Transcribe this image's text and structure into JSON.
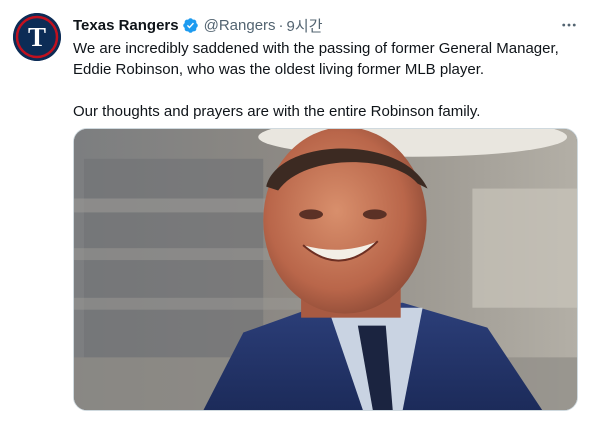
{
  "tweet": {
    "author_name": "Texas Rangers",
    "handle": "@Rangers",
    "separator": "·",
    "time": "9시간",
    "text_paragraph_1": "We are incredibly saddened with the passing of former General Manager, Eddie Robinson, who was the oldest living former MLB player.",
    "text_paragraph_2": "Our thoughts and prayers are with the entire Robinson family.",
    "avatar_letter": "T",
    "verified": true
  },
  "icons": {
    "verified": "verified-badge-icon",
    "more": "more-options-icon"
  },
  "colors": {
    "brand_navy": "#0c2c56",
    "brand_red": "#c0111f",
    "verified_blue": "#1d9bf0",
    "secondary_text": "#536471"
  }
}
